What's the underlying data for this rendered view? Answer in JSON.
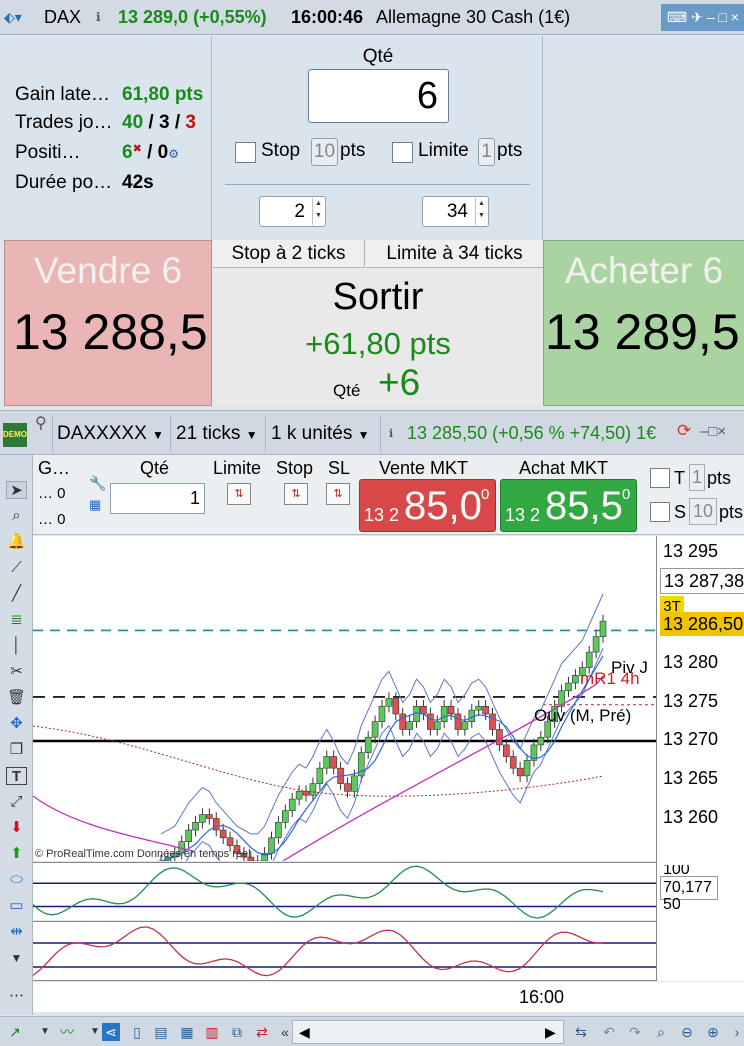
{
  "header": {
    "instrument": "DAX",
    "price_change": "13 289,0 (+0,55%)",
    "time": "16:00:46",
    "description": "Allemagne 30 Cash (1€)"
  },
  "stats": [
    {
      "label": "Gain late…",
      "value": "61,80 pts"
    },
    {
      "label": "Trades jo…",
      "v1": "40",
      "v2": "3",
      "v3": "3"
    },
    {
      "label": "Positi…",
      "v1": "6",
      "v2": "0"
    },
    {
      "label": "Durée po…",
      "value": "42s"
    }
  ],
  "ticket": {
    "qty_label": "Qté",
    "qty": "6",
    "stop_label": "Stop",
    "stop_pts": "10",
    "pts": "pts",
    "limit_label": "Limite",
    "limit_pts": "1",
    "stop_ticks": "2",
    "limit_ticks": "34"
  },
  "sell": {
    "title": "Vendre 6",
    "price": "13 288,5"
  },
  "buy": {
    "title": "Acheter 6",
    "price": "13 289,5"
  },
  "exit": {
    "stop_text": "Stop à 2 ticks",
    "limit_text": "Limite à 34 ticks",
    "title": "Sortir",
    "pnl": "+61,80 pts",
    "qty_label": "Qté",
    "qty": "+6"
  },
  "chart_toolbar": {
    "symbol": "DAXXXXX",
    "period": "21 ticks",
    "units": "1 k unités",
    "quote": "13 285,50 (+0,56 % +74,50) 1€"
  },
  "order_bar": {
    "g": "G…",
    "g_row1": "… 0",
    "g_row2": "… 0",
    "qty_label": "Qté",
    "qty": "1",
    "limite": "Limite",
    "stop": "Stop",
    "sl": "SL",
    "sell_label": "Vente MKT",
    "buy_label": "Achat MKT",
    "sell_prefix": "13 2",
    "sell_big": "85,0",
    "sell_sup": "0",
    "buy_prefix": "13 2",
    "buy_big": "85,5",
    "buy_sup": "0",
    "t_label": "T",
    "t_val": "1",
    "t_unit": "pts",
    "s_label": "S",
    "s_val": "10",
    "s_unit": "pts"
  },
  "chart_labels": {
    "piv": "Piv J",
    "mr1": "mR1 4h",
    "ouv": "Ouv (M, Pré)",
    "copyright": "© ProRealTime.com  Données en temps réel",
    "t3": "3T"
  },
  "axis": {
    "ticks": [
      "13 295",
      "13 280",
      "13 275",
      "13 270",
      "13 265",
      "13 260"
    ],
    "last_price": "13 287,38",
    "current_price": "13 286,50",
    "osc_ticks": [
      "100",
      "50"
    ],
    "osc_value": "70,177",
    "time_label": "16:00"
  },
  "chart_data": {
    "type": "candlestick",
    "ylim": [
      13256,
      13298
    ],
    "x_label": "16:00",
    "reference_lines": [
      {
        "name": "Piv J",
        "value": 13277.2
      },
      {
        "name": "mR1 4h",
        "value": 13276.2
      },
      {
        "name": "Ouv (M, Pré)",
        "value": 13271.5
      },
      {
        "name": "3T",
        "value": 13285.8
      }
    ],
    "closes": [
      13256,
      13256.5,
      13257,
      13258.5,
      13260,
      13261,
      13262,
      13261.5,
      13260,
      13259,
      13258,
      13257,
      13256.5,
      13256,
      13256,
      13257,
      13259,
      13261,
      13262.5,
      13264,
      13265,
      13264.5,
      13266,
      13268,
      13269.5,
      13268,
      13266,
      13265,
      13267,
      13270,
      13272,
      13274,
      13276,
      13277,
      13275,
      13273,
      13274,
      13276,
      13275,
      13273,
      13274,
      13276,
      13275,
      13273,
      13274,
      13275.5,
      13276,
      13275,
      13273,
      13271,
      13269.5,
      13268,
      13267,
      13269,
      13271,
      13272,
      13274,
      13276,
      13278,
      13279,
      13280,
      13281,
      13283,
      13285,
      13287
    ]
  }
}
